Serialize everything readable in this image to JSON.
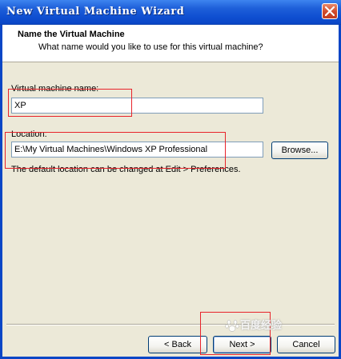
{
  "window": {
    "title": "New Virtual Machine Wizard",
    "icon_close": "close-icon"
  },
  "header": {
    "title": "Name the Virtual Machine",
    "subtitle": "What name would you like to use for this virtual machine?"
  },
  "form": {
    "name_label": "Virtual machine name:",
    "name_value": "XP",
    "location_label": "Location:",
    "location_value": "E:\\My Virtual Machines\\Windows XP Professional",
    "browse_label": "Browse...",
    "hint": "The default location can be changed at Edit > Preferences."
  },
  "buttons": {
    "back": "< Back",
    "next": "Next >",
    "cancel": "Cancel"
  },
  "watermark": {
    "text": "百度经验",
    "icon": "baidu-paw-icon"
  },
  "colors": {
    "titlebar": "#0a46c6",
    "annotation": "#e8232a",
    "dialog_bg": "#ece9d8"
  }
}
